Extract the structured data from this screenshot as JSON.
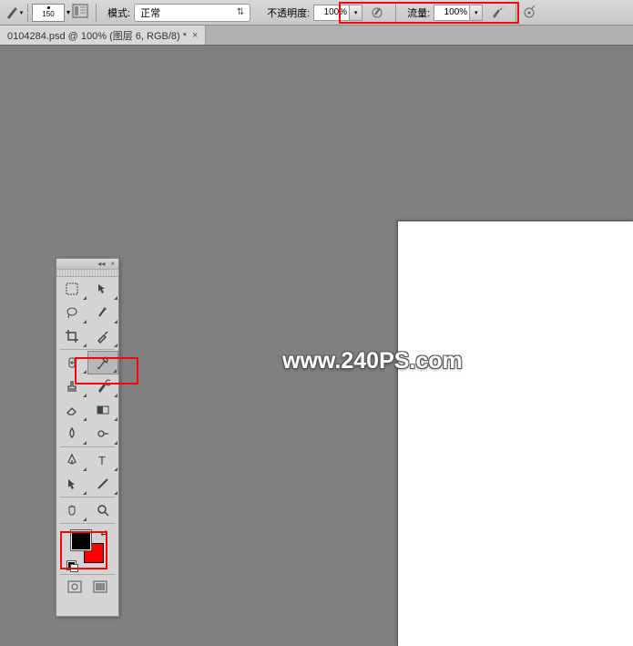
{
  "options_bar": {
    "brush_size": "150",
    "mode_label": "模式:",
    "mode_value": "正常",
    "opacity_label": "不透明度:",
    "opacity_value": "100%",
    "flow_label": "流量:",
    "flow_value": "100%"
  },
  "doc_tab": {
    "title": "0104284.psd @ 100% (图层 6, RGB/8) *"
  },
  "watermark": "www.240PS.com",
  "colors": {
    "foreground": "#000000",
    "background": "#ff0000"
  }
}
